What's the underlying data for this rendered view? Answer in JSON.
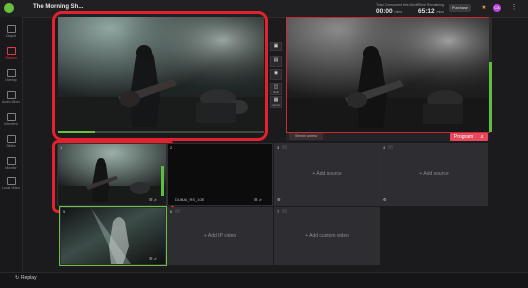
{
  "header": {
    "title": "The Morning Sh...",
    "stat1": {
      "label": "Total Consumed this Month",
      "value": "00:00",
      "unit": "mins"
    },
    "stat2": {
      "label": "Time Remaining",
      "value": "65:12",
      "unit": "mins"
    },
    "purchase_label": "Purchase",
    "avatar_initials": "CA"
  },
  "sidebar": {
    "items": [
      {
        "label": "Output"
      },
      {
        "label": "Record"
      },
      {
        "label": "Overlay"
      },
      {
        "label": "Audio Mixer"
      },
      {
        "label": "Interview"
      },
      {
        "label": "Slides"
      },
      {
        "label": "Monitor"
      },
      {
        "label": "Local Video"
      }
    ]
  },
  "tools": [
    {
      "label": ""
    },
    {
      "label": ""
    },
    {
      "label": ""
    },
    {
      "label": "Split"
    },
    {
      "label": "Quad"
    }
  ],
  "program": {
    "label": "Program",
    "sub_label": "Stream wontra"
  },
  "slots": [
    {
      "num": "1",
      "add_text": "",
      "foot": ""
    },
    {
      "num": "2",
      "add_text": "",
      "foot": "DUBAI_RS_10E"
    },
    {
      "num": "3",
      "add_text": "+ Add source",
      "foot": ""
    },
    {
      "num": "4",
      "add_text": "+ Add source",
      "foot": ""
    },
    {
      "num": "5",
      "add_text": "",
      "foot": ""
    },
    {
      "num": "6",
      "add_text": "+ Add IP video",
      "foot": ""
    },
    {
      "num": "7",
      "add_text": "+ Add custom video",
      "foot": ""
    }
  ],
  "bottom": {
    "replay_label": "Replay"
  },
  "colors": {
    "accent_red": "#e4212c",
    "program_red": "#e8495a",
    "live_green": "#6bbf3a",
    "avatar": "#b54ad8"
  }
}
